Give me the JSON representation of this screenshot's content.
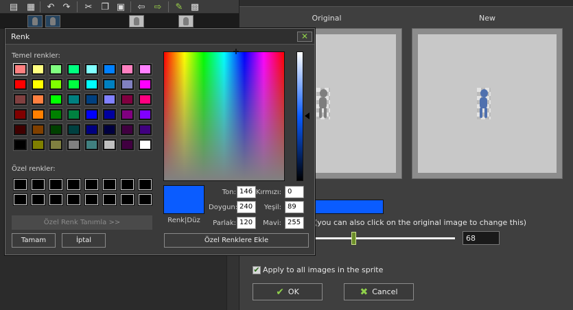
{
  "toolbar": {
    "icons": [
      "new-sprite-icon",
      "add-frame-icon",
      "undo-icon",
      "redo-icon",
      "cut-icon",
      "copy-icon",
      "paste-icon",
      "arrow-left-icon",
      "arrow-right-icon",
      "pencil-icon",
      "frames-icon"
    ]
  },
  "right_dialog": {
    "original_label": "Original",
    "new_label": "New",
    "color_swatch": "#0a5cff",
    "hint": "(you can also click on the original image to change this)",
    "slider_value": "68",
    "apply_all_label": "Apply to all images in the sprite",
    "ok_label": "OK",
    "cancel_label": "Cancel"
  },
  "color_dialog": {
    "title": "Renk",
    "basic_colors_label": "Temel renkler:",
    "basic_colors": [
      "#ff8080",
      "#ffff80",
      "#80ff80",
      "#00ff80",
      "#80ffff",
      "#0080ff",
      "#ff80c0",
      "#ff80ff",
      "#ff0000",
      "#ffff00",
      "#80ff00",
      "#00ff40",
      "#00ffff",
      "#0080c0",
      "#8080c0",
      "#ff00ff",
      "#804040",
      "#ff8040",
      "#00ff00",
      "#008080",
      "#004080",
      "#8080ff",
      "#800040",
      "#ff0080",
      "#800000",
      "#ff8000",
      "#008000",
      "#008040",
      "#0000ff",
      "#0000a0",
      "#800080",
      "#8000ff",
      "#400000",
      "#804000",
      "#004000",
      "#004040",
      "#000080",
      "#000040",
      "#400040",
      "#400080",
      "#000000",
      "#808000",
      "#808040",
      "#808080",
      "#408080",
      "#c0c0c0",
      "#400040",
      "#ffffff"
    ],
    "custom_colors_label": "Özel renkler:",
    "define_custom_label": "Özel Renk Tanımla >>",
    "ok_label": "Tamam",
    "cancel_label": "İptal",
    "add_custom_label": "Özel Renklere Ekle",
    "preview_label": "Renk|Düz",
    "hue_label": "Ton:",
    "hue": "146",
    "sat_label": "Doygun:",
    "sat": "240",
    "lum_label": "Parlak:",
    "lum": "120",
    "red_label": "Kırmızı:",
    "red": "0",
    "green_label": "Yeşil:",
    "green": "89",
    "blue_label": "Mavi:",
    "blue": "255",
    "current_color": "#0a5cff"
  }
}
